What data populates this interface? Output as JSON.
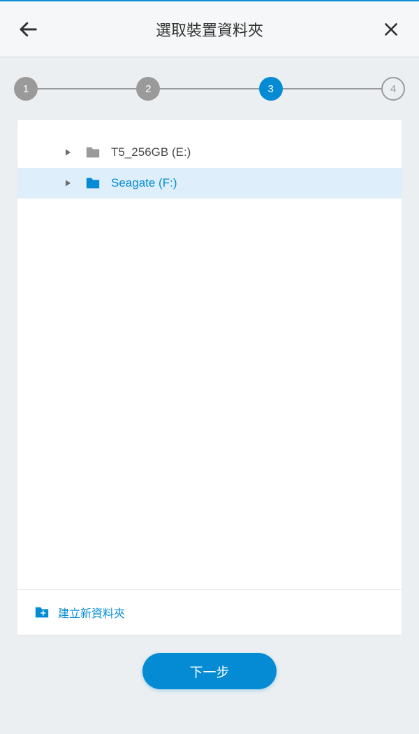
{
  "header": {
    "title": "選取裝置資料夾"
  },
  "stepper": {
    "steps": [
      {
        "num": "1",
        "state": "done"
      },
      {
        "num": "2",
        "state": "done"
      },
      {
        "num": "3",
        "state": "active"
      },
      {
        "num": "4",
        "state": "pending"
      }
    ]
  },
  "tree": {
    "items": [
      {
        "label": "T5_256GB (E:)",
        "selected": false
      },
      {
        "label": "Seagate (F:)",
        "selected": true
      }
    ]
  },
  "footer": {
    "new_folder_label": "建立新資料夾"
  },
  "actions": {
    "next_label": "下一步"
  },
  "colors": {
    "accent": "#048bd3",
    "grey": "#9a9a9a"
  }
}
